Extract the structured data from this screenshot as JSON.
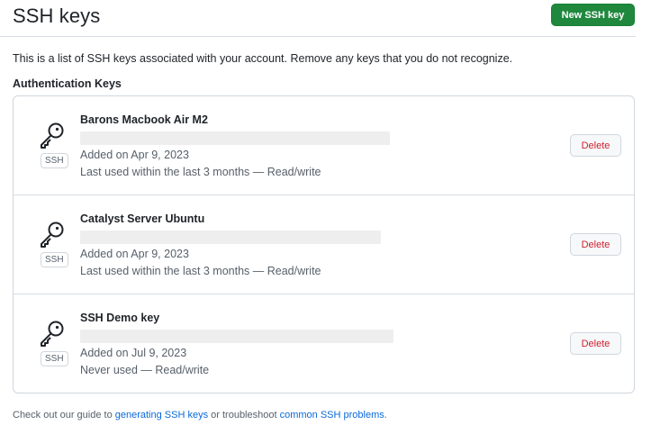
{
  "header": {
    "title": "SSH keys",
    "new_key_label": "New SSH key"
  },
  "description": "This is a list of SSH keys associated with your account. Remove any keys that you do not recognize.",
  "section_title": "Authentication Keys",
  "keys": [
    {
      "name": "Barons Macbook Air M2",
      "type_badge": "SSH",
      "added": "Added on Apr 9, 2023",
      "usage": "Last used within the last 3 months — Read/write",
      "delete_label": "Delete",
      "icon": "key-icon"
    },
    {
      "name": "Catalyst Server Ubuntu",
      "type_badge": "SSH",
      "added": "Added on Apr 9, 2023",
      "usage": "Last used within the last 3 months — Read/write",
      "delete_label": "Delete",
      "icon": "key-icon"
    },
    {
      "name": "SSH Demo key",
      "type_badge": "SSH",
      "added": "Added on Jul 9, 2023",
      "usage": "Never used — Read/write",
      "delete_label": "Delete",
      "icon": "key-icon"
    }
  ],
  "footer": {
    "prefix": "Check out our guide to ",
    "link1": "generating SSH keys",
    "middle": " or troubleshoot ",
    "link2": "common SSH problems",
    "suffix": "."
  },
  "colors": {
    "primary_button": "#1f883d",
    "danger_text": "#cf222e",
    "link": "#0969da",
    "muted_text": "#57606a",
    "border": "#d0d7de"
  }
}
